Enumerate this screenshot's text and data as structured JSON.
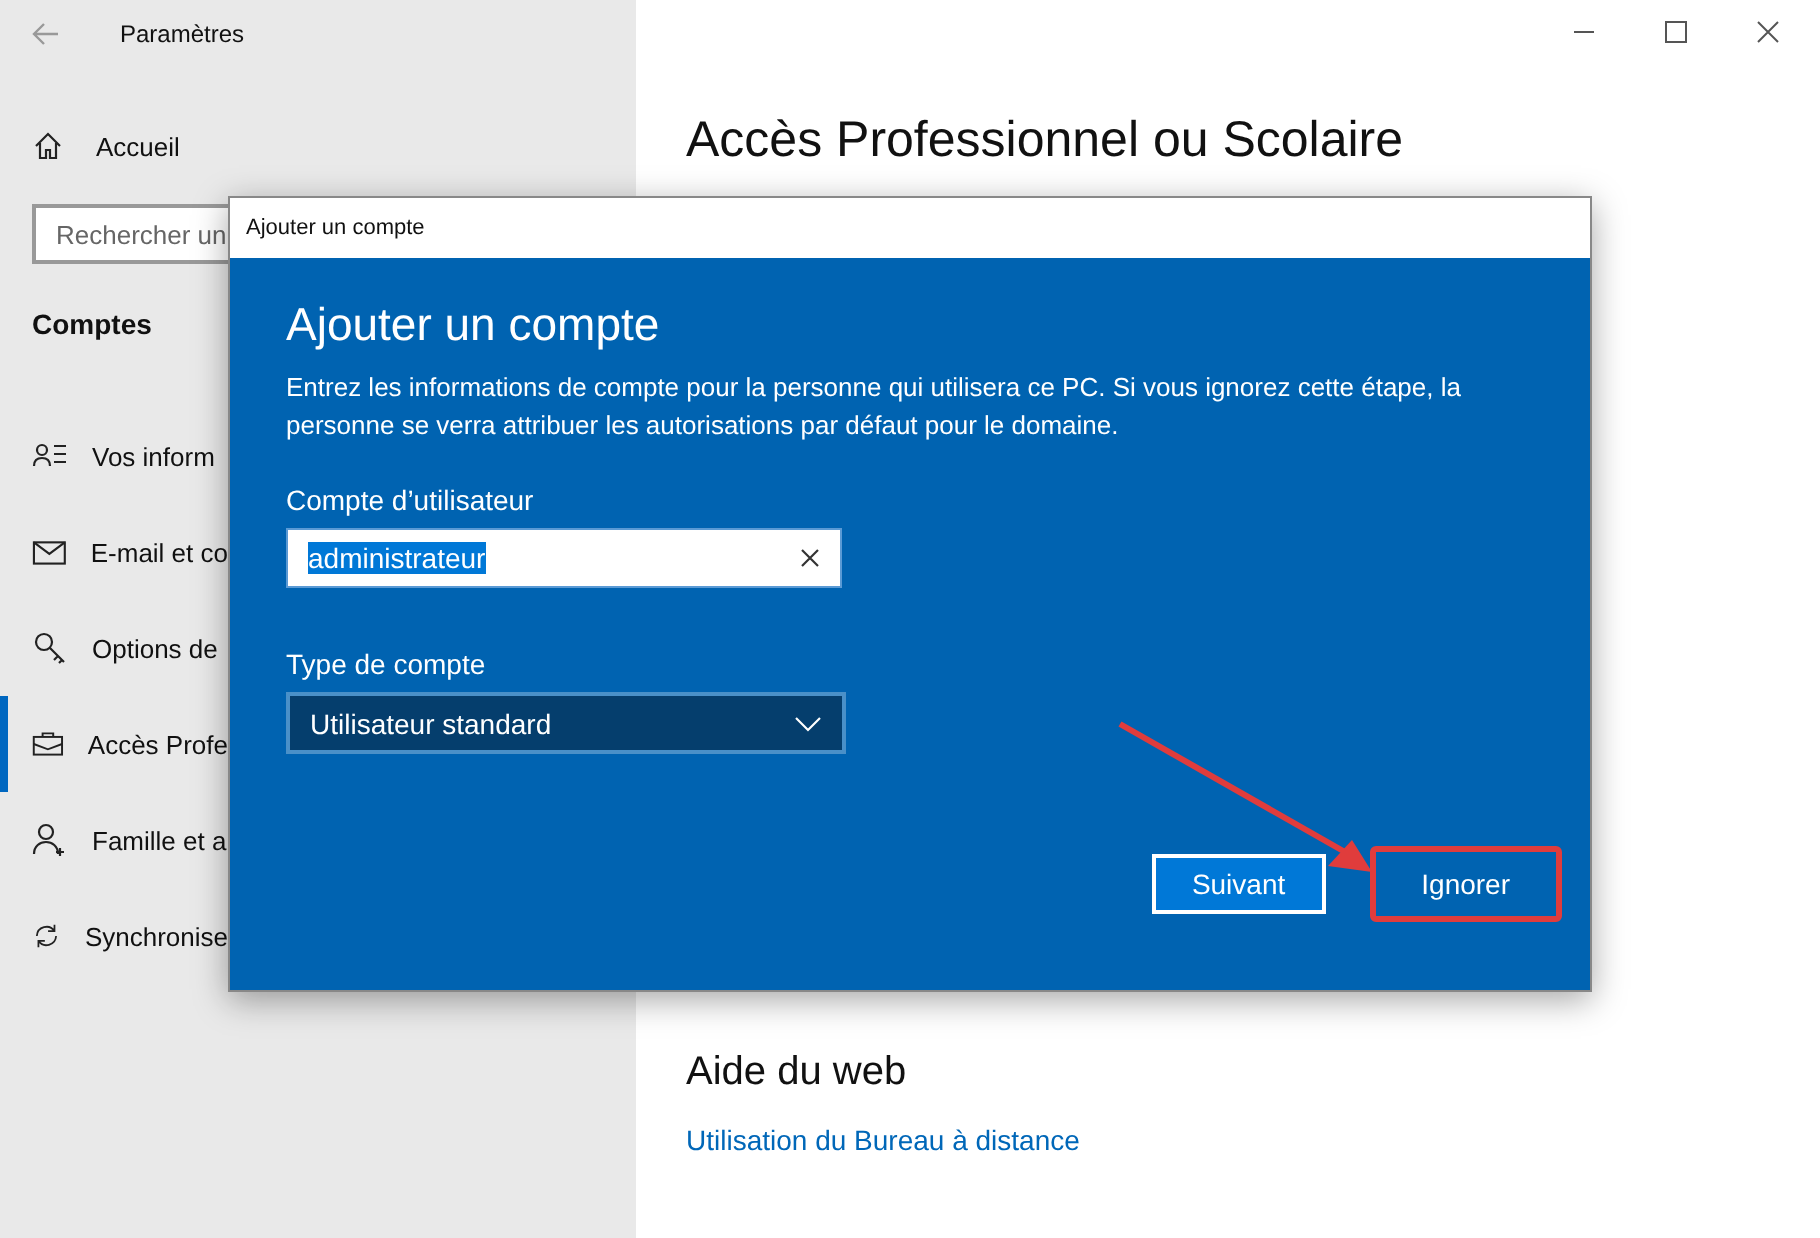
{
  "window": {
    "title": "Paramètres"
  },
  "sidebar": {
    "home": "Accueil",
    "search": {
      "placeholder": "Rechercher un"
    },
    "section": "Comptes",
    "items": [
      {
        "label": "Vos inform",
        "selected": false
      },
      {
        "label": "E-mail et co",
        "selected": false
      },
      {
        "label": "Options de",
        "selected": false
      },
      {
        "label": "Accès Profe",
        "selected": true
      },
      {
        "label": "Famille et a",
        "selected": false
      },
      {
        "label": "Synchronise",
        "selected": false
      }
    ]
  },
  "main": {
    "title": "Accès Professionnel ou Scolaire",
    "help_title": "Aide du web",
    "help_link": "Utilisation du Bureau à distance"
  },
  "dialog": {
    "title": "Ajouter un compte",
    "heading": "Ajouter un compte",
    "description": "Entrez les informations de compte pour la personne qui utilisera ce PC. Si vous ignorez cette étape, la personne se verra attribuer les autorisations par défaut pour le domaine.",
    "user_label": "Compte d’utilisateur",
    "user_value": "administrateur",
    "user_value_selected": true,
    "type_label": "Type de compte",
    "type_value": "Utilisateur standard",
    "buttons": [
      {
        "label": "Suivant",
        "kind": "primary",
        "highlighted": false
      },
      {
        "label": "Ignorer",
        "kind": "secondary",
        "highlighted": true
      }
    ]
  }
}
